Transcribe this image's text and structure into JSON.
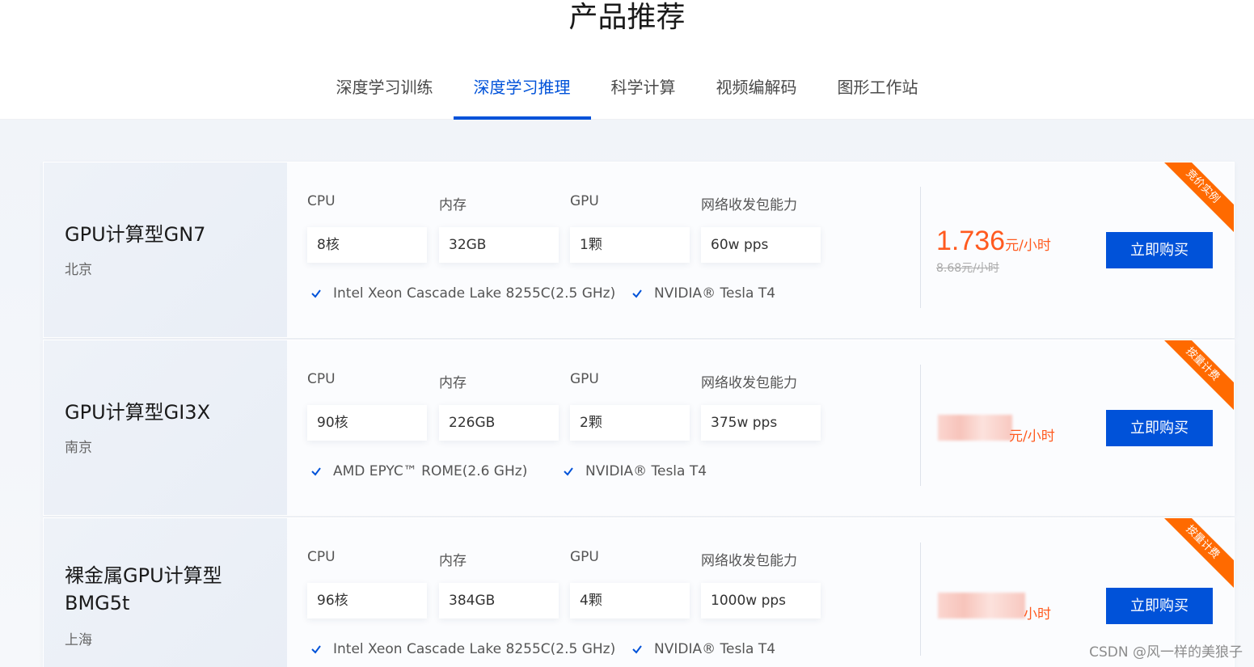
{
  "page_title": "产品推荐",
  "tabs": [
    {
      "label": "深度学习训练",
      "active": false
    },
    {
      "label": "深度学习推理",
      "active": true
    },
    {
      "label": "科学计算",
      "active": false
    },
    {
      "label": "视频编解码",
      "active": false
    },
    {
      "label": "图形工作站",
      "active": false
    }
  ],
  "spec_labels": {
    "cpu": "CPU",
    "memory": "内存",
    "gpu": "GPU",
    "network": "网络收发包能力"
  },
  "products": [
    {
      "name": "GPU计算型GN7",
      "region": "北京",
      "cpu": "8核",
      "memory": "32GB",
      "gpu": "1颗",
      "network": "60w pps",
      "features": [
        "Intel Xeon Cascade Lake 8255C(2.5 GHz)",
        "NVIDIA® Tesla T4"
      ],
      "price": "1.736",
      "price_unit": "元/小时",
      "original_price": "8.68元/小时",
      "buy_label": "立即购买",
      "ribbon": "竞价实例"
    },
    {
      "name": "GPU计算型GI3X",
      "region": "南京",
      "cpu": "90核",
      "memory": "226GB",
      "gpu": "2颗",
      "network": "375w pps",
      "features": [
        "AMD EPYC™ ROME(2.6 GHz)",
        "NVIDIA® Tesla T4"
      ],
      "price_unit": "元/小时",
      "buy_label": "立即购买",
      "ribbon": "按量计费"
    },
    {
      "name": "裸金属GPU计算型BMG5t",
      "region": "上海",
      "cpu": "96核",
      "memory": "384GB",
      "gpu": "4颗",
      "network": "1000w pps",
      "features": [
        "Intel Xeon Cascade Lake 8255C(2.5 GHz)",
        "NVIDIA® Tesla T4"
      ],
      "price_unit": "小时",
      "buy_label": "立即购买",
      "ribbon": "按量计费"
    }
  ],
  "watermark": "CSDN @风一样的美狼子",
  "colors": {
    "accent": "#0052d9",
    "price": "#ff5a1f",
    "ribbon": "#ff6a00"
  }
}
